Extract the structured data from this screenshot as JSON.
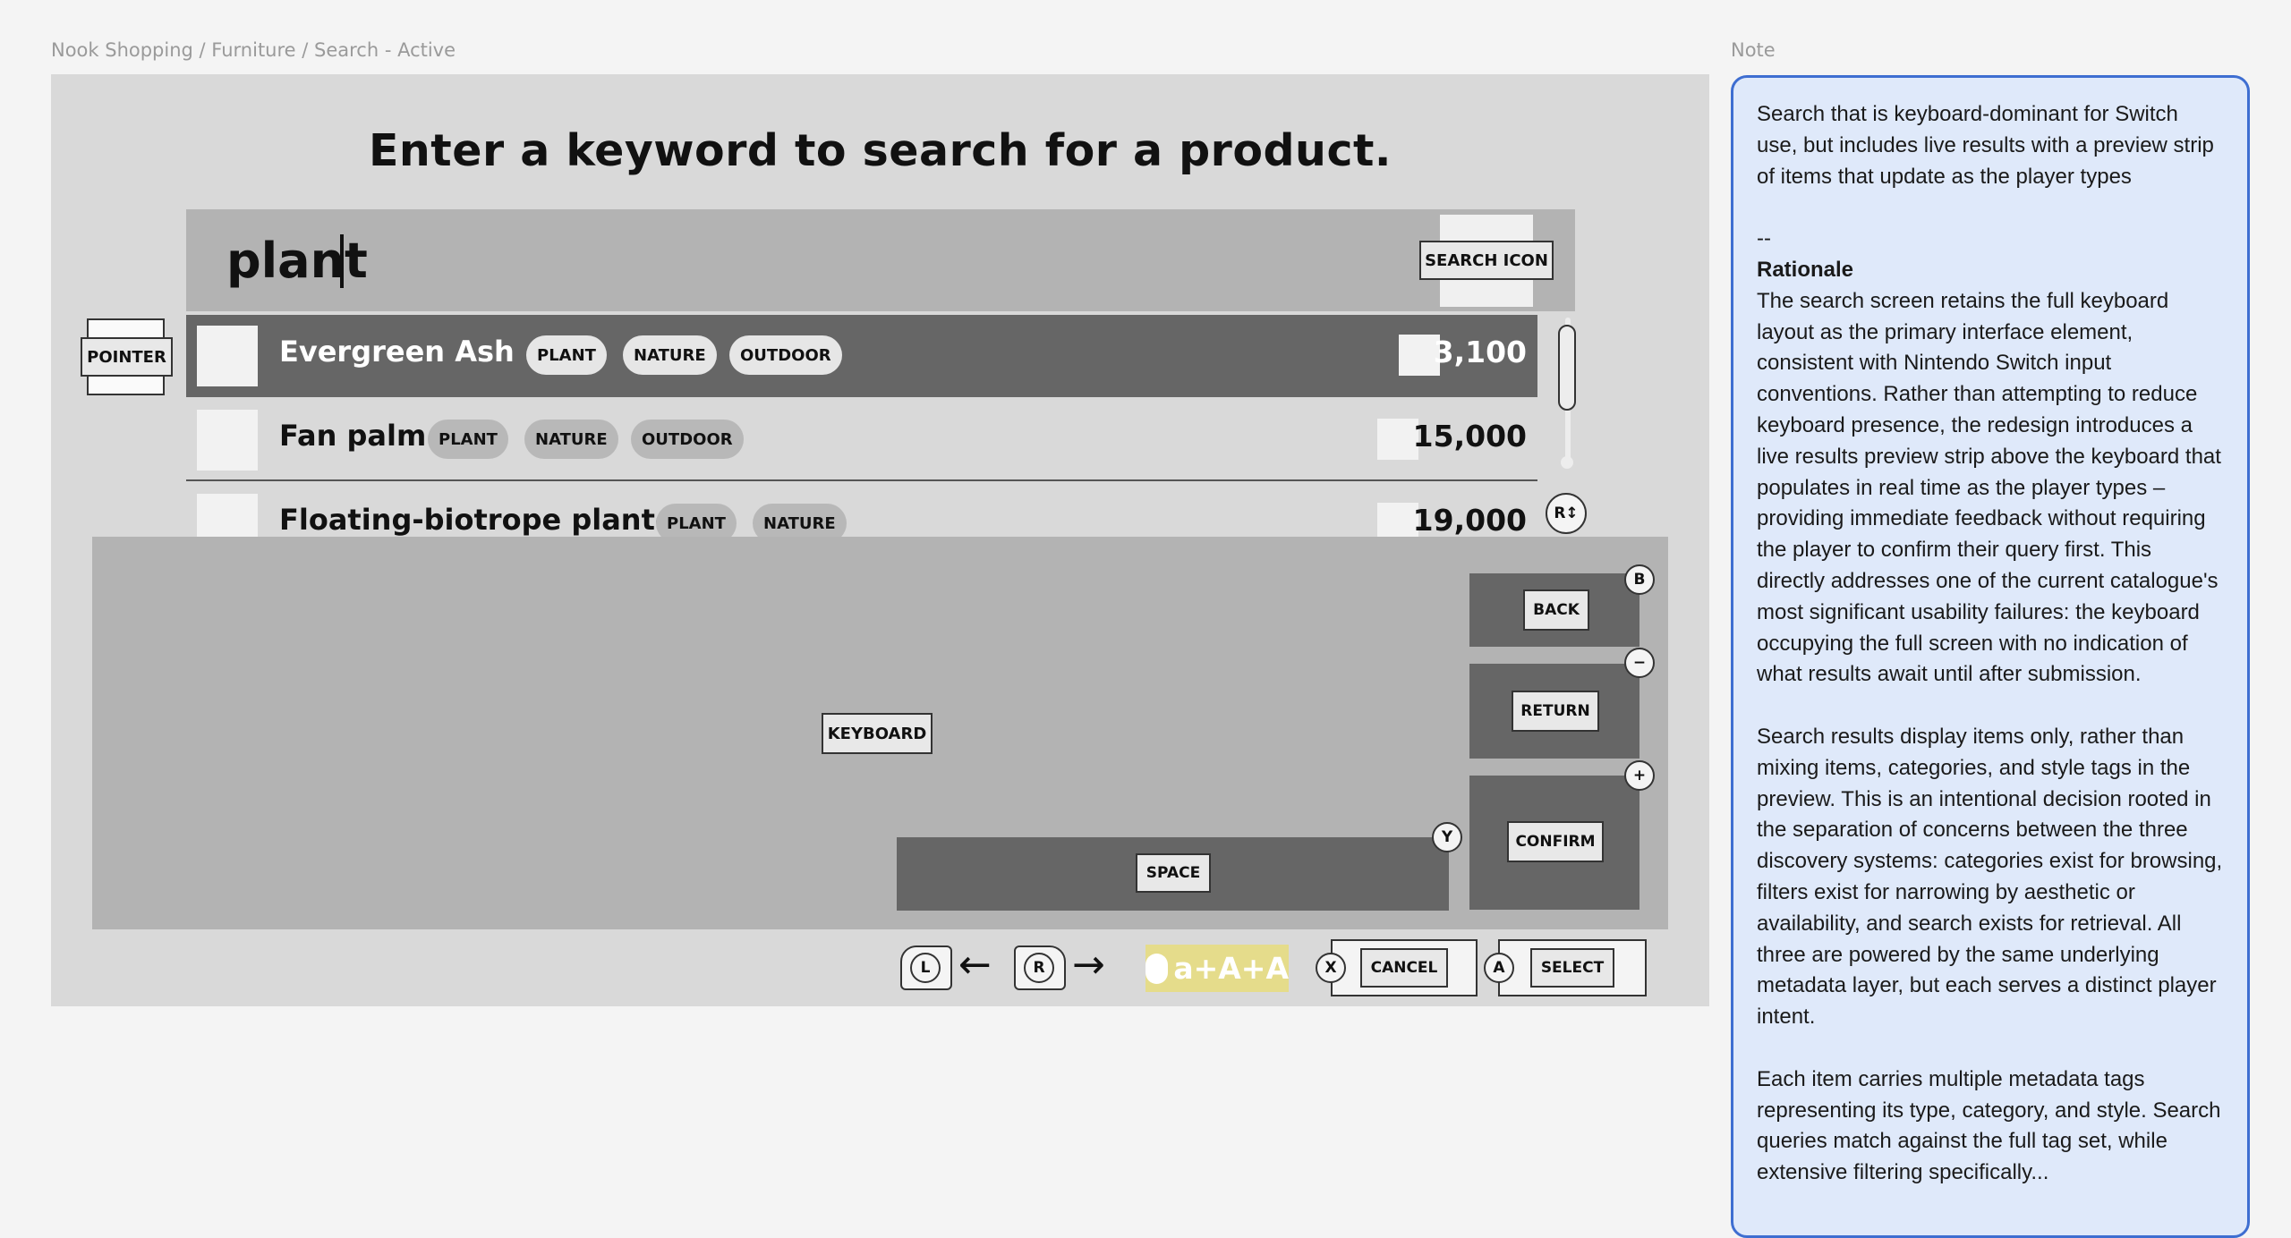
{
  "breadcrumb": "Nook Shopping / Furniture / Search - Active",
  "note_label": "Note",
  "heading": "Enter a keyword to search for a product.",
  "search": {
    "value": "plant",
    "icon_label": "SEARCH ICON"
  },
  "pointer_label": "POINTER",
  "results": [
    {
      "name": "Evergreen Ash",
      "tags": [
        "PLANT",
        "NATURE",
        "OUTDOOR"
      ],
      "price": "3,100",
      "active": true
    },
    {
      "name": "Fan palm",
      "tags": [
        "PLANT",
        "NATURE",
        "OUTDOOR"
      ],
      "price": "15,000",
      "active": false
    },
    {
      "name": "Floating-biotrope planter",
      "tags": [
        "PLANT",
        "NATURE"
      ],
      "price": "19,000",
      "active": false
    }
  ],
  "r_stick_label": "R↕",
  "keyboard": {
    "label": "KEYBOARD",
    "space_label": "SPACE",
    "space_button": "Y",
    "back_label": "BACK",
    "back_button": "B",
    "return_label": "RETURN",
    "return_button": "−",
    "confirm_label": "CONFIRM",
    "confirm_button": "+"
  },
  "bottom_bar": {
    "l_button": "L",
    "left_arrow": "←",
    "r_button": "R",
    "right_arrow": "→",
    "case_toggle": "a+A+A",
    "cancel_button": "X",
    "cancel_label": "CANCEL",
    "select_button": "A",
    "select_label": "SELECT"
  },
  "note": {
    "intro": "Search that is keyboard-dominant for Switch use, but includes live results with a preview strip of items that update as the player types",
    "separator": "--",
    "title": "Rationale",
    "p1": "The search screen retains the full keyboard layout as the primary interface element, consistent with Nintendo Switch input conventions. Rather than attempting to reduce keyboard presence, the redesign introduces a live results preview strip above the keyboard that populates in real time as the player types – providing immediate feedback without requiring the player to confirm their query first. This directly addresses one of the current catalogue's most significant usability failures: the keyboard occupying the full screen with no indication of what results await until after submission.",
    "p2": "Search results display items only, rather than mixing items, categories, and style tags in the preview. This is an intentional decision rooted in the separation of concerns between the three discovery systems: categories exist for browsing, filters exist for narrowing by aesthetic or availability, and search exists for retrieval. All three are powered by the same underlying metadata layer, but each serves a distinct player intent.",
    "p3": "Each item carries multiple metadata tags representing its type, category, and style. Search queries match against the full tag set, while extensive filtering specifically..."
  },
  "colors": {
    "frame": "#d9d9d9",
    "active_row": "#666666",
    "keyboard": "#b3b3b3",
    "note_bg": "#dfe9fa",
    "note_border": "#3e6ed1",
    "case_toggle": "#e5dc8b"
  }
}
